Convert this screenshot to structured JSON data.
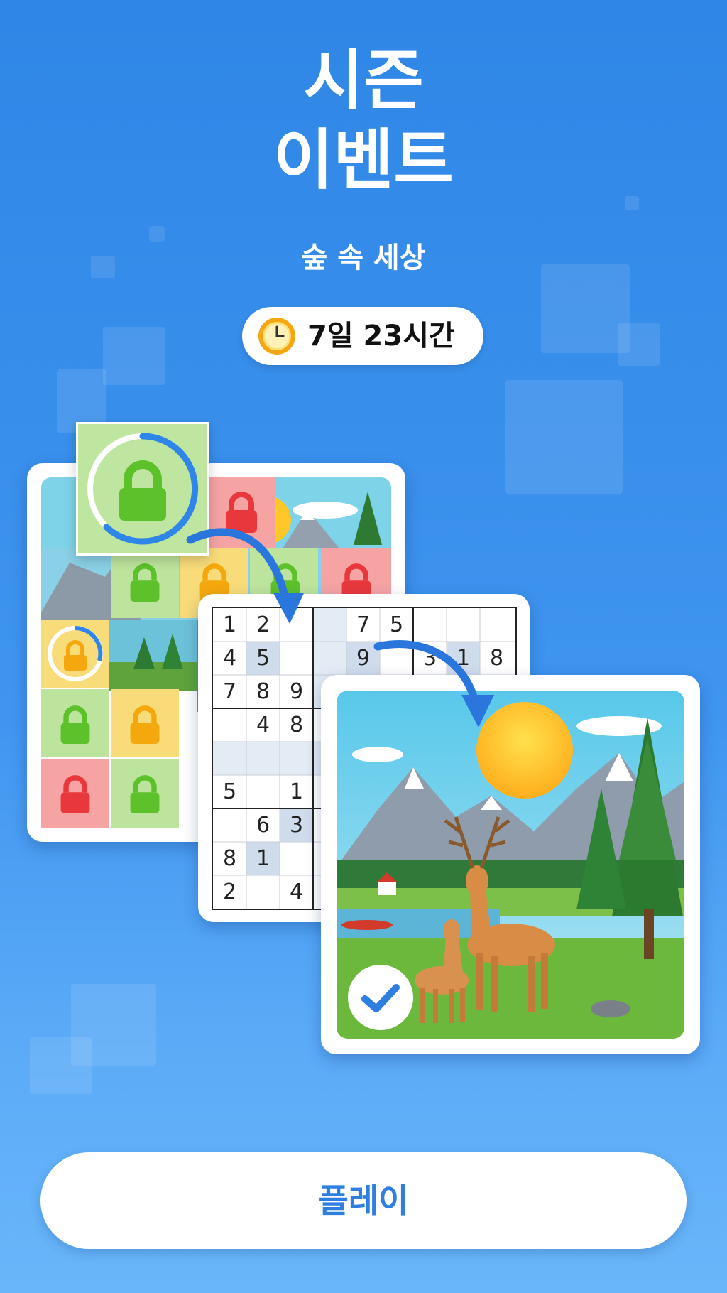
{
  "header": {
    "title_line1": "시즌",
    "title_line2": "이벤트",
    "subtitle": "숲 속 세상"
  },
  "timer": {
    "icon": "clock-icon",
    "text": "7일 23시간"
  },
  "sudoku": {
    "cells": [
      {
        "r": 0,
        "c": 0,
        "v": "1"
      },
      {
        "r": 0,
        "c": 1,
        "v": "2"
      },
      {
        "r": 0,
        "c": 4,
        "v": "7"
      },
      {
        "r": 0,
        "c": 5,
        "v": "5"
      },
      {
        "r": 1,
        "c": 0,
        "v": "4"
      },
      {
        "r": 1,
        "c": 1,
        "v": "5"
      },
      {
        "r": 1,
        "c": 4,
        "v": "9"
      },
      {
        "r": 1,
        "c": 6,
        "v": "3"
      },
      {
        "r": 1,
        "c": 7,
        "v": "1"
      },
      {
        "r": 1,
        "c": 8,
        "v": "8"
      },
      {
        "r": 2,
        "c": 0,
        "v": "7"
      },
      {
        "r": 2,
        "c": 1,
        "v": "8"
      },
      {
        "r": 2,
        "c": 2,
        "v": "9"
      },
      {
        "r": 3,
        "c": 1,
        "v": "4"
      },
      {
        "r": 3,
        "c": 2,
        "v": "8"
      },
      {
        "r": 5,
        "c": 0,
        "v": "5"
      },
      {
        "r": 5,
        "c": 2,
        "v": "1"
      },
      {
        "r": 6,
        "c": 1,
        "v": "6"
      },
      {
        "r": 6,
        "c": 2,
        "v": "3"
      },
      {
        "r": 7,
        "c": 0,
        "v": "8"
      },
      {
        "r": 7,
        "c": 1,
        "v": "1"
      },
      {
        "r": 8,
        "c": 0,
        "v": "2"
      },
      {
        "r": 8,
        "c": 2,
        "v": "4"
      }
    ]
  },
  "colors": {
    "background": "#2f86e6",
    "lock_green": "#5cc12a",
    "lock_yellow": "#f5a80d",
    "lock_red": "#e8383d",
    "button_text": "#2f7fe0"
  },
  "play_button": {
    "label": "플레이"
  }
}
